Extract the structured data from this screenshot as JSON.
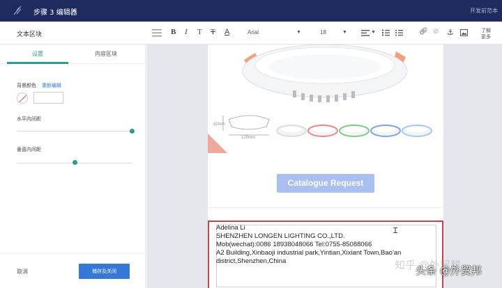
{
  "topbar": {
    "step_label": "步骤 3  编辑器",
    "right_link": "开发前范本"
  },
  "toolbar": {
    "block_title": "文本区块",
    "font_name": "Arial",
    "font_size": "18",
    "more_line1": "了解",
    "more_line2": "更多",
    "icons": [
      "hamburger-icon",
      "bold-icon",
      "italic-icon",
      "text-size-icon",
      "strikethrough-icon",
      "font-color-icon",
      "align-icon",
      "ordered-list-icon",
      "bullet-list-icon",
      "link-icon",
      "unlink-icon",
      "anchor-icon",
      "image-icon"
    ]
  },
  "left_panel": {
    "tabs": [
      "设置",
      "内容区块"
    ],
    "active_tab": 0,
    "bg_color_label": "背景颜色",
    "bg_color_reset": "重新编辑",
    "h_padding_label": "水平内间距",
    "v_padding_label": "垂直内间距",
    "cancel_label": "取消",
    "save_label": "储存及关闭",
    "accent": "#2a9d8f"
  },
  "canvas": {
    "dim_height": "32mm",
    "dim_width": "120mm",
    "catalogue_button": "Catalogue Request",
    "contact": {
      "line1": "Adelina Li",
      "line2": "SHENZHEN LONGEN LIGHTING CO.,LTD.",
      "line3": "Mob(wechat):0086 18938048066  Tel:0755-85088066",
      "line4": "A2 Building,Xinbaoji industrial park,Yintian,Xixiant Town,Bao'an",
      "line5": "district,Shenzhen,China"
    },
    "ring_colors": [
      "#d9dde4",
      "#e58a8a",
      "#7fc98a",
      "#7fa3e6",
      "#a9c7ee"
    ]
  },
  "watermark": {
    "text": "知乎 @外贸邦",
    "overlay": "头条 @外贸邦"
  }
}
